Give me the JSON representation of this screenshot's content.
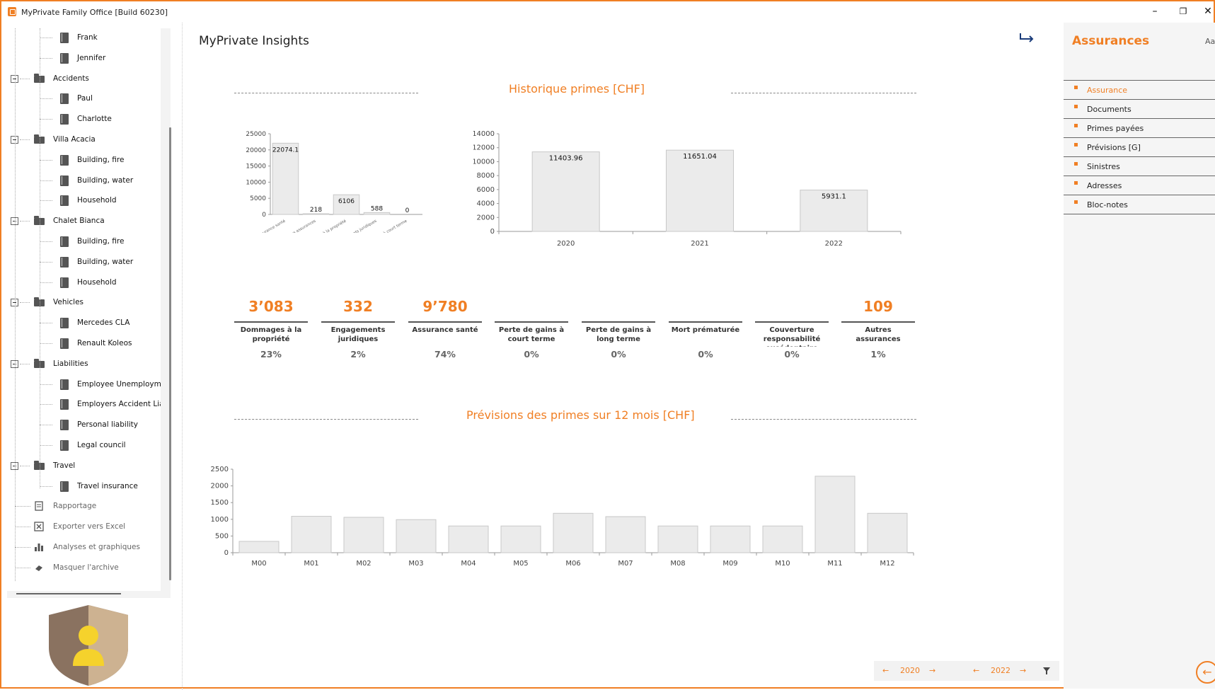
{
  "window": {
    "title": "MyPrivate Family Office [Build 60230]",
    "controls": {
      "minimize": "–",
      "restore": "❐",
      "close": "✕"
    }
  },
  "tree": {
    "items": [
      {
        "label": "Frank",
        "level": 3,
        "icon": "document-icon"
      },
      {
        "label": "Jennifer",
        "level": 3,
        "icon": "document-icon"
      },
      {
        "label": "Accidents",
        "level": 2,
        "icon": "folder-icon",
        "expanded": true
      },
      {
        "label": "Paul",
        "level": 3,
        "icon": "document-icon"
      },
      {
        "label": "Charlotte",
        "level": 3,
        "icon": "document-icon"
      },
      {
        "label": "Villa Acacia",
        "level": 2,
        "icon": "folder-icon",
        "expanded": true
      },
      {
        "label": "Building, fire",
        "level": 3,
        "icon": "document-icon"
      },
      {
        "label": "Building, water",
        "level": 3,
        "icon": "document-icon"
      },
      {
        "label": "Household",
        "level": 3,
        "icon": "document-icon"
      },
      {
        "label": "Chalet Bianca",
        "level": 2,
        "icon": "folder-icon",
        "expanded": true
      },
      {
        "label": "Building, fire",
        "level": 3,
        "icon": "document-icon"
      },
      {
        "label": "Building, water",
        "level": 3,
        "icon": "document-icon"
      },
      {
        "label": "Household",
        "level": 3,
        "icon": "document-icon"
      },
      {
        "label": "Vehicles",
        "level": 2,
        "icon": "folder-icon",
        "expanded": true
      },
      {
        "label": "Mercedes CLA",
        "level": 3,
        "icon": "document-icon"
      },
      {
        "label": "Renault Koleos",
        "level": 3,
        "icon": "document-icon"
      },
      {
        "label": "Liabilities",
        "level": 2,
        "icon": "folder-icon",
        "expanded": true
      },
      {
        "label": "Employee Unemploymer",
        "level": 3,
        "icon": "document-icon"
      },
      {
        "label": "Employers Accident Liab",
        "level": 3,
        "icon": "document-icon"
      },
      {
        "label": "Personal liability",
        "level": 3,
        "icon": "document-icon"
      },
      {
        "label": "Legal council",
        "level": 3,
        "icon": "document-icon"
      },
      {
        "label": "Travel",
        "level": 2,
        "icon": "folder-icon",
        "expanded": true
      },
      {
        "label": "Travel insurance",
        "level": 3,
        "icon": "document-icon"
      }
    ],
    "utilities": [
      {
        "label": "Rapportage",
        "icon": "report-icon"
      },
      {
        "label": "Exporter vers Excel",
        "icon": "excel-icon"
      },
      {
        "label": "Analyses et graphiques",
        "icon": "bar-chart-icon"
      },
      {
        "label": "Masquer l'archive",
        "icon": "eraser-icon"
      }
    ]
  },
  "main": {
    "title": "MyPrivate Insights",
    "history_title": "Historique primes [CHF]",
    "forecast_title": "Prévisions des primes sur 12 mois [CHF]",
    "kpis": [
      {
        "value": "3’083",
        "label": "Dommages à la propriété",
        "pct": "23%"
      },
      {
        "value": "332",
        "label": "Engagements juridiques",
        "pct": "2%"
      },
      {
        "value": "9’780",
        "label": "Assurance santé",
        "pct": "74%"
      },
      {
        "value": "",
        "label": "Perte de gains à court terme",
        "pct": "0%"
      },
      {
        "value": "",
        "label": "Perte de gains à long terme",
        "pct": "0%"
      },
      {
        "value": "",
        "label": "Mort prématurée",
        "pct": "0%"
      },
      {
        "value": "",
        "label": "Couverture responsabilité excédentaire",
        "pct": "0%"
      },
      {
        "value": "109",
        "label": "Autres assurances",
        "pct": "1%"
      }
    ]
  },
  "chart_data": [
    {
      "type": "bar",
      "title": "",
      "categories": [
        "Assurance santé",
        "Autres assurances",
        "Dommages à la propriété",
        "Engagements juridiques",
        "Perte de gains à court terme"
      ],
      "values": [
        22074.1,
        218,
        6106,
        588,
        0
      ],
      "ylim": [
        0,
        25000
      ],
      "yticks": [
        0,
        5000,
        10000,
        15000,
        20000,
        25000
      ]
    },
    {
      "type": "bar",
      "title": "",
      "categories": [
        "2020",
        "2021",
        "2022"
      ],
      "values": [
        11403.96,
        11651.04,
        5931.1
      ],
      "ylim": [
        0,
        14000
      ],
      "yticks": [
        0,
        2000,
        4000,
        6000,
        8000,
        10000,
        12000,
        14000
      ]
    },
    {
      "type": "bar",
      "title": "",
      "categories": [
        "M00",
        "M01",
        "M02",
        "M03",
        "M04",
        "M05",
        "M06",
        "M07",
        "M08",
        "M09",
        "M10",
        "M11",
        "M12"
      ],
      "values": [
        340,
        1090,
        1060,
        990,
        800,
        800,
        1180,
        1080,
        800,
        800,
        800,
        2290,
        1180
      ],
      "ylim": [
        0,
        2500
      ],
      "yticks": [
        0,
        500,
        1000,
        1500,
        2000,
        2500
      ]
    }
  ],
  "rightpanel": {
    "title": "Assurances",
    "aa": "Aa",
    "items": [
      {
        "label": "Assurance",
        "active": true
      },
      {
        "label": "Documents"
      },
      {
        "label": "Primes payées"
      },
      {
        "label": "Prévisions [G]"
      },
      {
        "label": "Sinistres"
      },
      {
        "label": "Adresses"
      },
      {
        "label": "Bloc-notes"
      }
    ]
  },
  "footer": {
    "year_from": "2020",
    "year_to": "2022",
    "prev_arrow": "←",
    "next_arrow": "→",
    "filter_icon": "filter-icon"
  },
  "colors": {
    "accent": "#f07f24",
    "bar": "#ebebeb",
    "bar_stroke": "#c8c8c8"
  }
}
